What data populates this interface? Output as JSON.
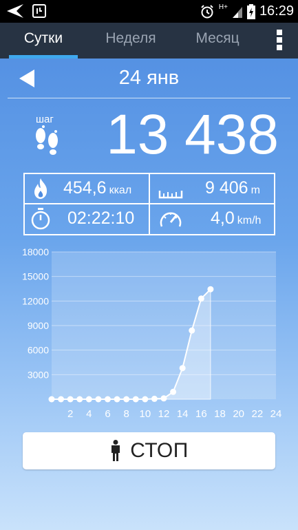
{
  "status_bar": {
    "time": "16:29",
    "network": "H+",
    "icons": [
      "back-arrow-icon",
      "notification-icon",
      "alarm-icon",
      "signal-icon",
      "battery-charging-icon"
    ]
  },
  "tabs": [
    {
      "label": "Сутки",
      "active": true
    },
    {
      "label": "Неделя",
      "active": false
    },
    {
      "label": "Месяц",
      "active": false
    }
  ],
  "date": "24 янв",
  "steps": {
    "label": "шаг",
    "count": "13 438"
  },
  "stats": {
    "calories": {
      "value": "454,6",
      "unit": "ккал",
      "icon": "flame-icon"
    },
    "distance": {
      "value": "9 406",
      "unit": "m",
      "icon": "ruler-icon"
    },
    "duration": {
      "value": "02:22:10",
      "icon": "stopwatch-icon"
    },
    "speed": {
      "value": "4,0",
      "unit": "km/h",
      "icon": "speedometer-icon"
    }
  },
  "chart_data": {
    "type": "line",
    "x": [
      0,
      1,
      2,
      3,
      4,
      5,
      6,
      7,
      8,
      9,
      10,
      11,
      12,
      13,
      14,
      15,
      16,
      17
    ],
    "series": [
      {
        "values": [
          0,
          0,
          0,
          0,
          0,
          0,
          0,
          0,
          0,
          0,
          0,
          50,
          100,
          900,
          3800,
          8400,
          12300,
          13438
        ]
      }
    ],
    "xticks": [
      2,
      4,
      6,
      8,
      10,
      12,
      14,
      16,
      18,
      20,
      22,
      24
    ],
    "yticks": [
      3000,
      6000,
      9000,
      12000,
      15000,
      18000
    ],
    "xlim": [
      0,
      24
    ],
    "ylim": [
      0,
      18000
    ],
    "grid": true
  },
  "stop_button": {
    "label": "СТОП",
    "icon": "person-icon"
  }
}
